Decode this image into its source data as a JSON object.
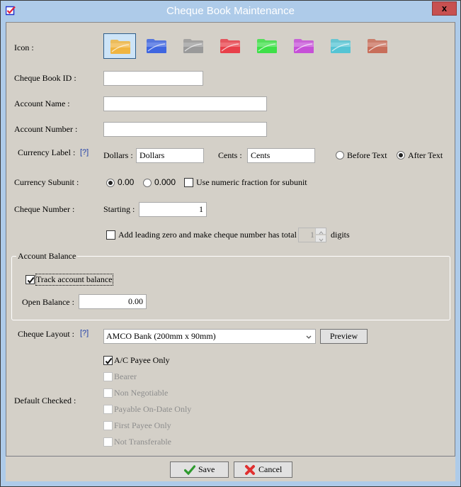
{
  "window": {
    "title": "Cheque Book Maintenance",
    "close_label": "x"
  },
  "icon_row": {
    "label": "Icon :",
    "folders": [
      {
        "name": "yellow",
        "color": "#f0b540",
        "selected": true
      },
      {
        "name": "blue",
        "color": "#3f66e0",
        "selected": false
      },
      {
        "name": "gray",
        "color": "#9a9a9a",
        "selected": false
      },
      {
        "name": "red",
        "color": "#e8404a",
        "selected": false
      },
      {
        "name": "green",
        "color": "#3ee048",
        "selected": false
      },
      {
        "name": "purple",
        "color": "#c650d8",
        "selected": false
      },
      {
        "name": "cyan",
        "color": "#55c4d4",
        "selected": false
      },
      {
        "name": "brown",
        "color": "#c86e5a",
        "selected": false
      }
    ]
  },
  "fields": {
    "cheque_book_id": {
      "label": "Cheque Book ID :",
      "value": ""
    },
    "account_name": {
      "label": "Account Name :",
      "value": ""
    },
    "account_number": {
      "label": "Account Number :",
      "value": ""
    }
  },
  "currency_label": {
    "label": "Currency Label :",
    "help": "[?]",
    "dollars_label": "Dollars :",
    "dollars_value": "Dollars",
    "cents_label": "Cents :",
    "cents_value": "Cents",
    "before_text": "Before Text",
    "after_text": "After Text",
    "position_selected": "After Text"
  },
  "currency_subunit": {
    "label": "Currency Subunit :",
    "option_2dp": "0.00",
    "option_3dp": "0.000",
    "selected": "0.00",
    "numeric_fraction_label": "Use numeric fraction for subunit",
    "numeric_fraction_checked": false
  },
  "cheque_number": {
    "label": "Cheque Number :",
    "starting_label": "Starting :",
    "starting_value": "1",
    "leading_zero_label": "Add leading zero and make cheque number has total",
    "leading_zero_checked": false,
    "digits_value": "1",
    "digits_suffix": "digits"
  },
  "account_balance": {
    "group_title": "Account Balance",
    "track_label": "Track account balance",
    "track_checked": true,
    "open_balance_label": "Open Balance :",
    "open_balance_value": "0.00"
  },
  "cheque_layout": {
    "label": "Cheque Layout :",
    "help": "[?]",
    "selected": "AMCO Bank (200mm x 90mm)",
    "preview_label": "Preview"
  },
  "default_checked": {
    "label": "Default Checked :",
    "options": [
      {
        "label": "A/C Payee Only",
        "checked": true,
        "enabled": true
      },
      {
        "label": "Bearer",
        "checked": false,
        "enabled": false
      },
      {
        "label": "Non Negotiable",
        "checked": false,
        "enabled": false
      },
      {
        "label": "Payable On-Date Only",
        "checked": false,
        "enabled": false
      },
      {
        "label": "First Payee Only",
        "checked": false,
        "enabled": false
      },
      {
        "label": "Not Transferable",
        "checked": false,
        "enabled": false
      }
    ]
  },
  "footer": {
    "save_label": "Save",
    "cancel_label": "Cancel"
  },
  "colors": {
    "title_bar": "#aecbe9",
    "close_button": "#c75050",
    "dialog_bg": "#d4d0c8",
    "help_link": "#1f3fa8"
  }
}
